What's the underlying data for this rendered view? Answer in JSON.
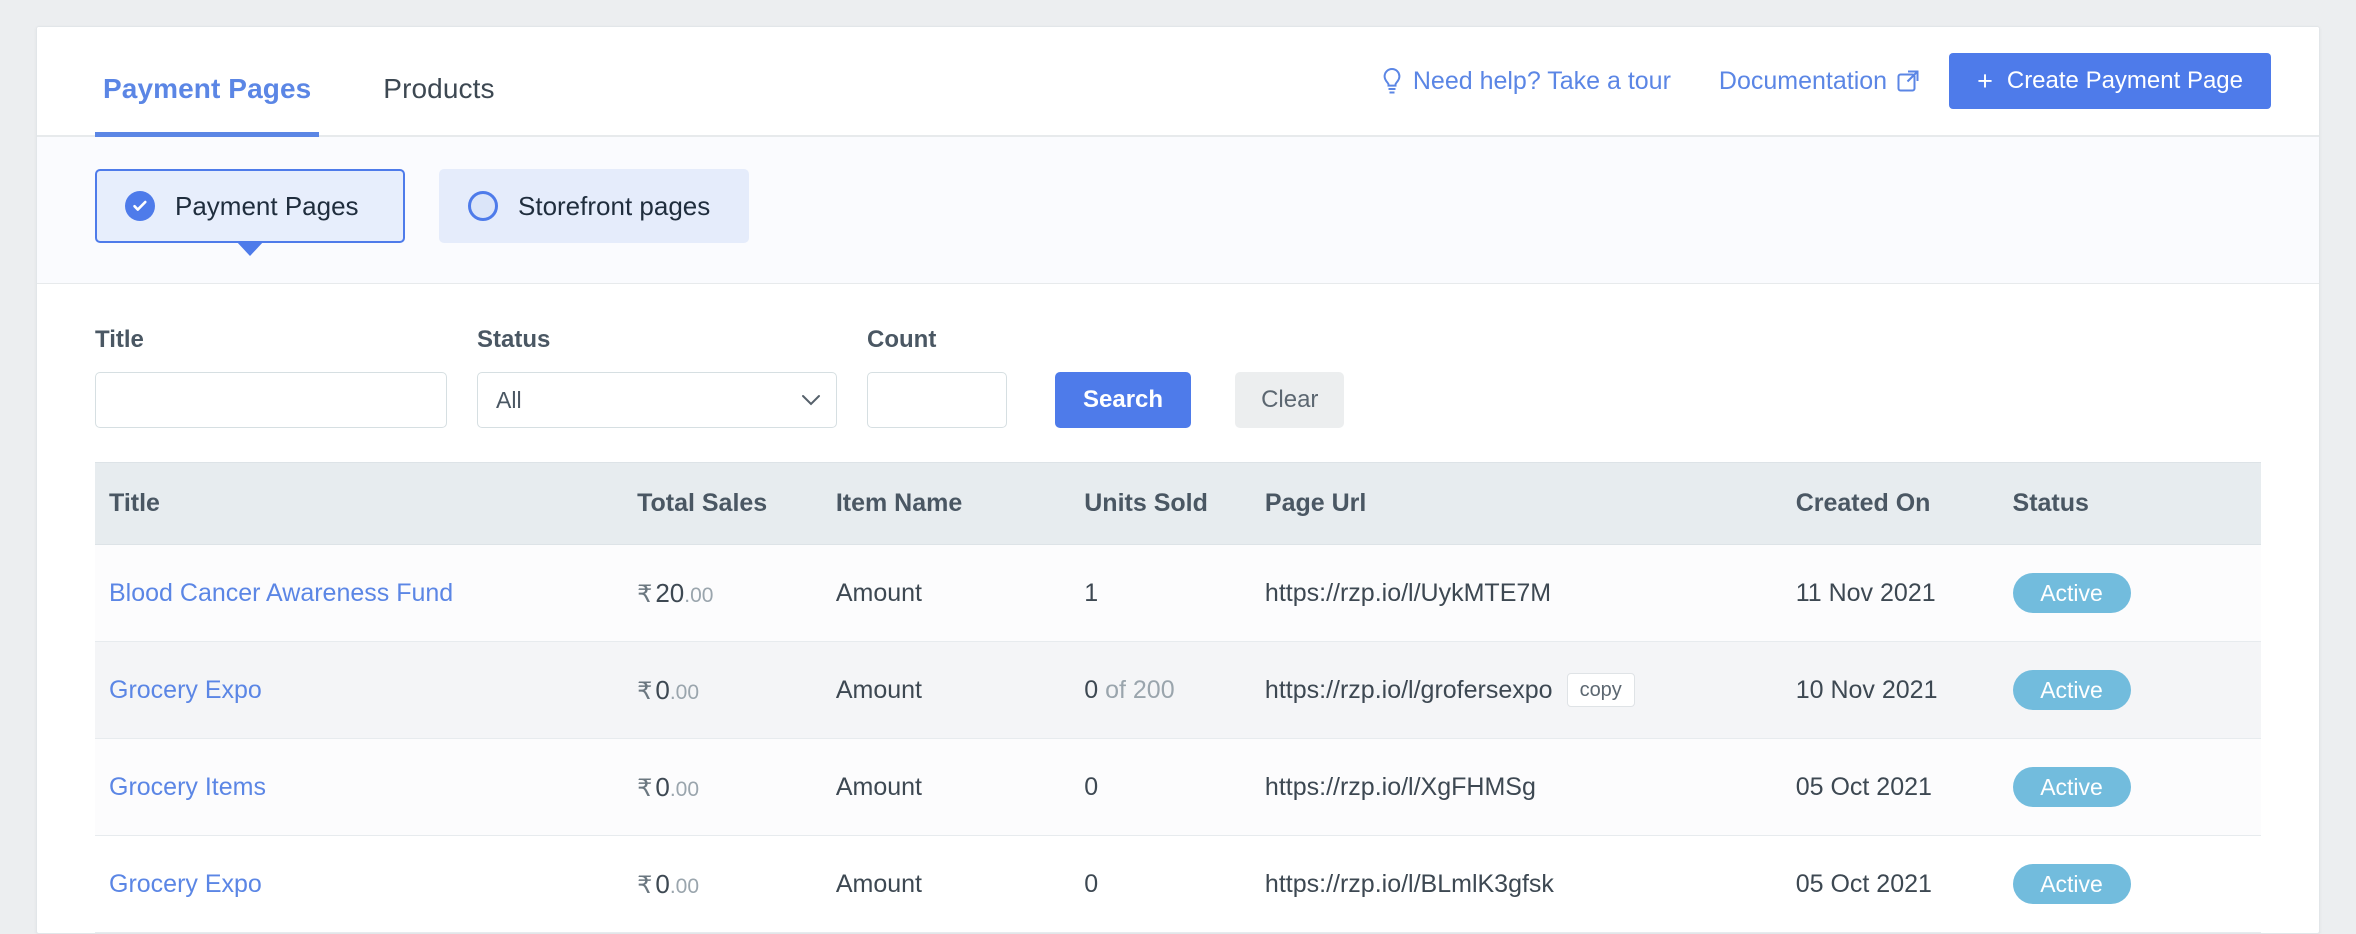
{
  "tabs": [
    {
      "label": "Payment Pages",
      "active": true
    },
    {
      "label": "Products",
      "active": false
    }
  ],
  "header": {
    "help_label": "Need help? Take a tour",
    "help_icon": "lightbulb-icon",
    "documentation_label": "Documentation",
    "documentation_icon": "external-link-icon",
    "create_button": "Create Payment Page",
    "create_button_plus": "+"
  },
  "page_type_choices": [
    {
      "label": "Payment Pages",
      "selected": true,
      "icon": "check-circle-icon"
    },
    {
      "label": "Storefront pages",
      "selected": false,
      "icon": "radio-unchecked-icon"
    }
  ],
  "filters": {
    "title": {
      "label": "Title",
      "value": "",
      "placeholder": ""
    },
    "status": {
      "label": "Status",
      "value": "All",
      "options": [
        "All"
      ]
    },
    "count": {
      "label": "Count",
      "value": "",
      "placeholder": ""
    },
    "search_label": "Search",
    "clear_label": "Clear"
  },
  "table": {
    "columns": [
      "Title",
      "Total Sales",
      "Item Name",
      "Units Sold",
      "Page Url",
      "Created On",
      "Status"
    ],
    "rows": [
      {
        "title": "Blood Cancer Awareness Fund",
        "currency": "₹",
        "amount_major": "20",
        "amount_minor": ".00",
        "item_name": "Amount",
        "units_sold": "1",
        "units_sold_suffix": "",
        "page_url": "https://rzp.io/l/UykMTE7M",
        "copy_label": "",
        "created_on": "11 Nov 2021",
        "status": "Active"
      },
      {
        "title": "Grocery Expo",
        "currency": "₹",
        "amount_major": "0",
        "amount_minor": ".00",
        "item_name": "Amount",
        "units_sold": "0",
        "units_sold_suffix": " of 200",
        "page_url": "https://rzp.io/l/grofersexpo",
        "copy_label": "copy",
        "created_on": "10 Nov 2021",
        "status": "Active"
      },
      {
        "title": "Grocery Items",
        "currency": "₹",
        "amount_major": "0",
        "amount_minor": ".00",
        "item_name": "Amount",
        "units_sold": "0",
        "units_sold_suffix": "",
        "page_url": "https://rzp.io/l/XgFHMSg",
        "copy_label": "",
        "created_on": "05 Oct 2021",
        "status": "Active"
      },
      {
        "title": "Grocery Expo",
        "currency": "₹",
        "amount_major": "0",
        "amount_minor": ".00",
        "item_name": "Amount",
        "units_sold": "0",
        "units_sold_suffix": "",
        "page_url": "https://rzp.io/l/BLmlK3gfsk",
        "copy_label": "",
        "created_on": "05 Oct 2021",
        "status": "Active"
      }
    ]
  },
  "colors": {
    "accent_blue": "#4e7bea",
    "link_blue": "#5b86e5",
    "status_badge": "#72bcdd",
    "header_bg": "#e7ecef",
    "choice_bg": "#e5ecfb"
  }
}
